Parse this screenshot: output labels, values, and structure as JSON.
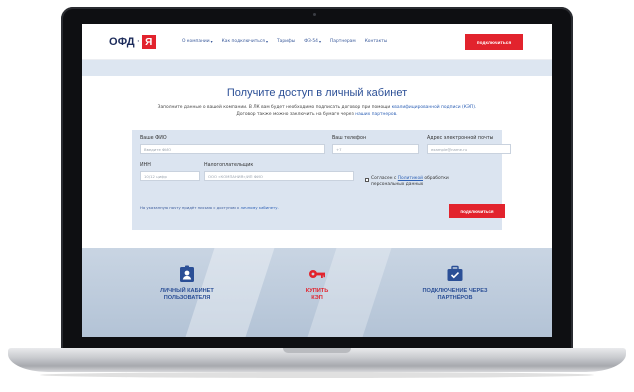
{
  "logo": {
    "text": "ОФД",
    "separator": "·",
    "mark": "Я"
  },
  "nav": {
    "items": [
      {
        "label": "О компании",
        "dropdown": true
      },
      {
        "label": "Как подключиться",
        "dropdown": true
      },
      {
        "label": "Тарифы",
        "dropdown": false
      },
      {
        "label": "ФЗ-54",
        "dropdown": true
      },
      {
        "label": "Партнерам",
        "dropdown": false
      },
      {
        "label": "Контакты",
        "dropdown": false
      }
    ],
    "cta": "подключиться",
    "chevron": "▾"
  },
  "page": {
    "title": "Получите доступ в личный кабинет",
    "subtitle_line1_prefix": "Заполните данные о вашей компании. В ЛК вам будет необходимо подписать договор при помощи ",
    "subtitle_line1_link": "квалифицированной подписи (КЭП).",
    "subtitle_line2_prefix": "Договор также можно заключить на бумаге через ",
    "subtitle_line2_link": "наших партнеров."
  },
  "form": {
    "fio_label": "Ваше ФИО",
    "fio_placeholder": "Введите ФИО",
    "phone_label": "Ваш телефон",
    "phone_placeholder": "+7",
    "email_label": "Адрес электронной почты",
    "email_placeholder": "example@name.ru",
    "inn_label": "ИНН",
    "inn_placeholder": "10/12 цифр",
    "payer_label": "Налогоплательщик",
    "payer_placeholder": "ООО «КОМПАНИЯ»/ИП ФИО",
    "agree_prefix": "Согласен с ",
    "agree_link": "Политикой",
    "agree_suffix": " обработки персональных данных",
    "note_prefix": "На указанную почту придёт письмо с доступом к ",
    "note_link": "личному кабинету.",
    "submit": "подключиться"
  },
  "banner": {
    "tiles": [
      {
        "line1": "ЛИЧНЫЙ КАБИНЕТ",
        "line2": "ПОЛЬЗОВАТЕЛЯ",
        "icon": "user-badge-icon",
        "color": "#2b4f96"
      },
      {
        "line1": "КУПИТЬ",
        "line2": "КЭП",
        "icon": "key-icon",
        "color": "#e2232d"
      },
      {
        "line1": "ПОДКЛЮЧЕНИЕ ЧЕРЕЗ",
        "line2": "ПАРТНЁРОВ",
        "icon": "briefcase-check-icon",
        "color": "#2b4f96"
      }
    ]
  },
  "colors": {
    "accent": "#e2232d",
    "brand": "#2b4f96",
    "band": "#dde6f1"
  }
}
